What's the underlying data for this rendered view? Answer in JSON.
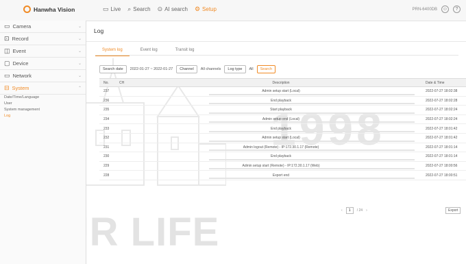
{
  "brand": {
    "name": "Hanwha Vision"
  },
  "top_nav": [
    {
      "icon": "monitor-icon",
      "label": "Live"
    },
    {
      "icon": "search-icon",
      "label": "Search"
    },
    {
      "icon": "ai-search-icon",
      "label": "AI search"
    },
    {
      "icon": "gear-icon",
      "label": "Setup"
    }
  ],
  "top_right": {
    "user": "PRN-6400DB",
    "icons": [
      "user-icon",
      "help-icon"
    ]
  },
  "sidebar": {
    "items": [
      {
        "icon": "camera-icon",
        "label": "Camera"
      },
      {
        "icon": "record-icon",
        "label": "Record"
      },
      {
        "icon": "event-icon",
        "label": "Event"
      },
      {
        "icon": "device-icon",
        "label": "Device"
      },
      {
        "icon": "network-icon",
        "label": "Network"
      },
      {
        "icon": "system-icon",
        "label": "System"
      }
    ],
    "sub_items": [
      {
        "label": "Date/Time/Language"
      },
      {
        "label": "User"
      },
      {
        "label": "System management"
      },
      {
        "label": "Log"
      }
    ]
  },
  "page": {
    "title": "Log"
  },
  "tabs": [
    {
      "label": "System log"
    },
    {
      "label": "Event log"
    },
    {
      "label": "Transit log"
    }
  ],
  "filters": {
    "search_date_label": "Search date",
    "date_range": "2022-01-27 ~ 2022-01-27",
    "channel_label": "Channel",
    "channel_value": "All channels",
    "log_type_label": "Log type",
    "log_type_value": "All",
    "search_button": "Search"
  },
  "table": {
    "headers": {
      "no": "No.",
      "ch": "CH",
      "description": "Description",
      "date": "Date & Time"
    },
    "rows": [
      {
        "no": "237",
        "ch": "",
        "description": "Admin setup start (Local)",
        "date": "2022-07-27 18:02:38"
      },
      {
        "no": "236",
        "ch": "",
        "description": "End playback",
        "date": "2022-07-27 18:02:28"
      },
      {
        "no": "235",
        "ch": "",
        "description": "Start playback",
        "date": "2022-07-27 18:02:24"
      },
      {
        "no": "234",
        "ch": "",
        "description": "Admin setup end (Local)",
        "date": "2022-07-27 18:02:24"
      },
      {
        "no": "233",
        "ch": "",
        "description": "End playback",
        "date": "2022-07-27 18:01:42"
      },
      {
        "no": "232",
        "ch": "",
        "description": "Admin setup start (Local)",
        "date": "2022-07-27 18:01:42"
      },
      {
        "no": "231",
        "ch": "",
        "description": "Admin logout (Remote) - IP:172.30.1.17 (Remote)",
        "date": "2022-07-27 18:01:14"
      },
      {
        "no": "230",
        "ch": "",
        "description": "End playback",
        "date": "2022-07-27 18:01:14"
      },
      {
        "no": "229",
        "ch": "",
        "description": "Admin setup start (Remote) - IP:172.30.1.17 (Web)",
        "date": "2022-07-27 18:00:56"
      },
      {
        "no": "228",
        "ch": "",
        "description": "Export end",
        "date": "2022-07-27 18:00:51"
      }
    ]
  },
  "pagination": {
    "current": "1",
    "total": "/ 24"
  },
  "export_button": "Export",
  "watermark": {
    "year": "1998",
    "slogan": "YOUR LIFE"
  },
  "colors": {
    "accent": "#f08a24"
  }
}
